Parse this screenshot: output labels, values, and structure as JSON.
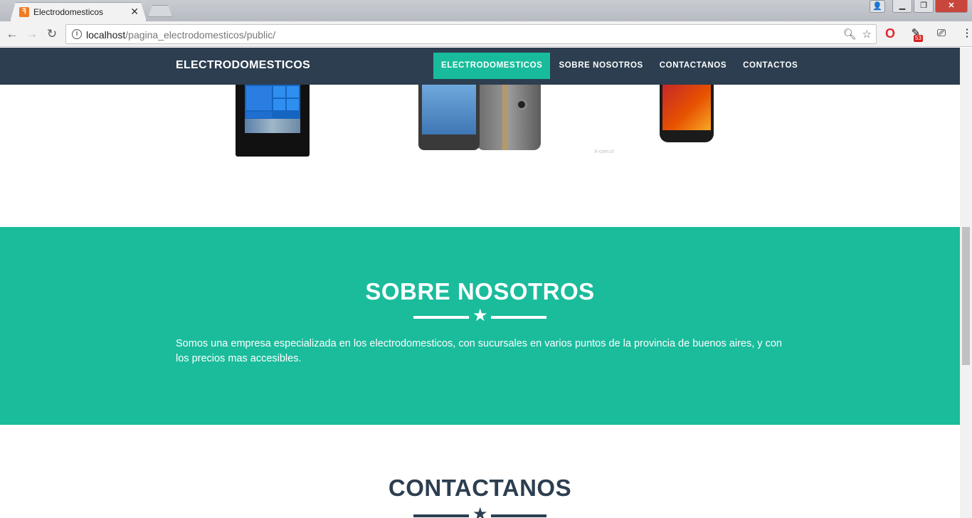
{
  "browser": {
    "tab_title": "Electrodomesticos",
    "tab_favicon": "xampp-icon",
    "url_host": "localhost",
    "url_path": "/pagina_electrodomesticos/public/",
    "extension_badge": "53"
  },
  "navbar": {
    "brand": "ELECTRODOMESTICOS",
    "items": [
      {
        "label": "ELECTRODOMESTICOS",
        "active": true
      },
      {
        "label": "SOBRE NOSOTROS",
        "active": false
      },
      {
        "label": "CONTACTANOS",
        "active": false
      },
      {
        "label": "CONTACTOS",
        "active": false
      }
    ]
  },
  "products": {
    "watermark": "X-com.cl"
  },
  "about": {
    "title": "SOBRE NOSOTROS",
    "text": "Somos una empresa especializada en los electrodomesticos, con sucursales en varios puntos de la provincia de buenos aires, y con los precios mas accesibles."
  },
  "contact": {
    "title": "CONTACTANOS"
  },
  "colors": {
    "navbar_bg": "#2c3e50",
    "accent": "#18bc9c",
    "about_bg": "#1abc9c",
    "about_divider": "#ffffff",
    "contact_divider": "#2c3e50"
  }
}
